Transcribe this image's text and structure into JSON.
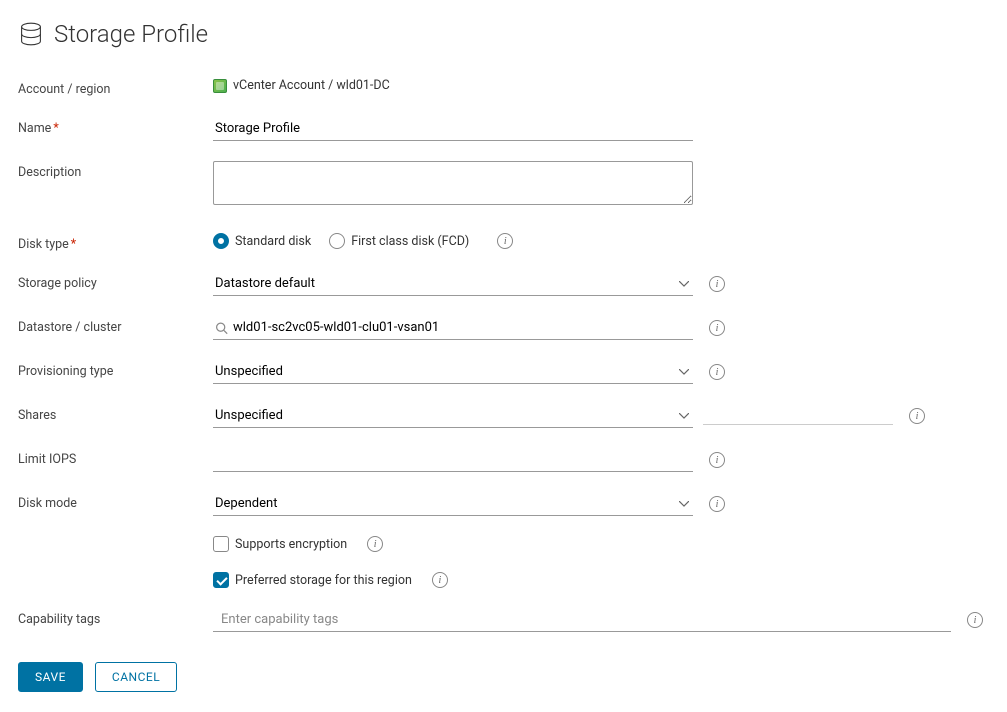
{
  "page": {
    "title": "Storage Profile"
  },
  "labels": {
    "account_region": "Account / region",
    "name": "Name",
    "description": "Description",
    "disk_type": "Disk type",
    "storage_policy": "Storage policy",
    "datastore_cluster": "Datastore / cluster",
    "provisioning_type": "Provisioning type",
    "shares": "Shares",
    "limit_iops": "Limit IOPS",
    "disk_mode": "Disk mode",
    "capability_tags": "Capability tags"
  },
  "values": {
    "account_region": "vCenter Account / wld01-DC",
    "name": "Storage Profile",
    "description": "",
    "disk_type_options": {
      "standard": "Standard disk",
      "fcd": "First class disk (FCD)"
    },
    "disk_type_selected": "standard",
    "storage_policy": "Datastore default",
    "datastore_cluster": "wld01-sc2vc05-wld01-clu01-vsan01",
    "provisioning_type": "Unspecified",
    "shares": "Unspecified",
    "limit_iops": "",
    "disk_mode": "Dependent",
    "supports_encryption_label": "Supports encryption",
    "supports_encryption_checked": false,
    "preferred_storage_label": "Preferred storage for this region",
    "preferred_storage_checked": true,
    "capability_tags_placeholder": "Enter capability tags"
  },
  "buttons": {
    "save": "SAVE",
    "cancel": "CANCEL"
  }
}
